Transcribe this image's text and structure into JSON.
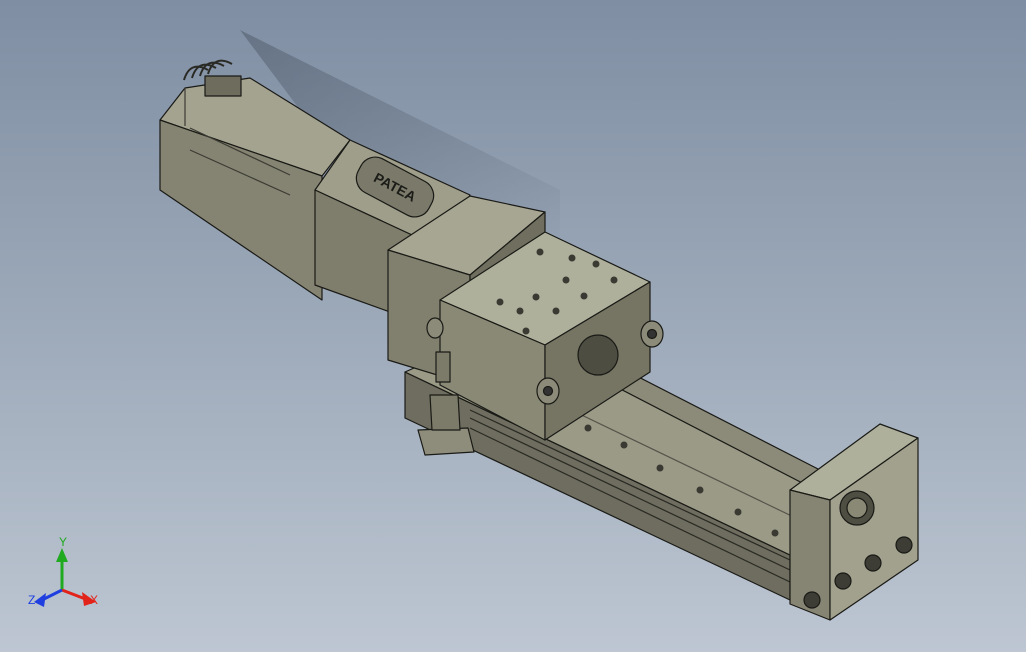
{
  "viewport": {
    "background_top": "#7f8ea3",
    "background_bottom": "#bdc6d2"
  },
  "model": {
    "motor_label": "PATEA",
    "body_color": "#8b8a78",
    "edge_color": "#1a1a16"
  },
  "triad": {
    "x_label": "X",
    "y_label": "Y",
    "z_label": "Z",
    "x_color": "#e2231a",
    "y_color": "#1faa1f",
    "z_color": "#1f3fe0"
  }
}
